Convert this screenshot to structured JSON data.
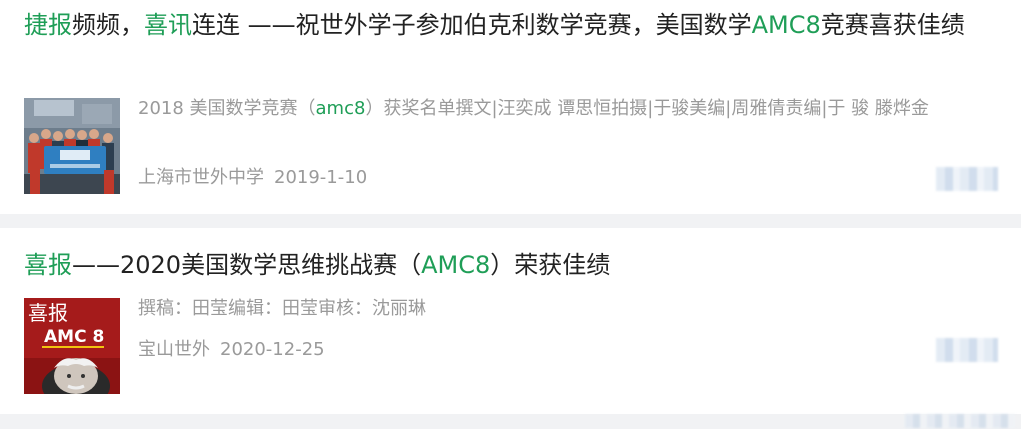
{
  "articles": [
    {
      "title_parts": [
        {
          "text": "捷报",
          "hl": true
        },
        {
          "text": "频频，",
          "hl": false
        },
        {
          "text": "喜讯",
          "hl": true
        },
        {
          "text": "连连 ——祝世外学子参加伯克利数学竞赛，美国数学",
          "hl": false
        },
        {
          "text": "AMC8",
          "hl": true
        },
        {
          "text": "竞赛喜获佳绩",
          "hl": false
        }
      ],
      "desc_parts": [
        {
          "text": "2018 美国数学竞赛（",
          "hl": false
        },
        {
          "text": "amc8",
          "hl": true
        },
        {
          "text": "）获奖名单撰文|汪奕成 谭思恒拍摄|于骏美编|周雅倩责编|于 骏 滕烨金",
          "hl": false
        }
      ],
      "source": "上海市世外中学",
      "date": "2019-1-10",
      "thumb_icon": "award-group-photo-icon"
    },
    {
      "title_parts": [
        {
          "text": "喜报",
          "hl": true
        },
        {
          "text": "——2020美国数学思维挑战赛（",
          "hl": false
        },
        {
          "text": "AMC8",
          "hl": true
        },
        {
          "text": "）荣获佳绩",
          "hl": false
        }
      ],
      "desc_parts": [
        {
          "text": "撰稿：田莹编辑：田莹审核：沈丽琳",
          "hl": false
        }
      ],
      "source": "宝山世外",
      "date": "2020-12-25",
      "thumb_icon": "good-news-poster-icon",
      "thumb_text": {
        "line1": "喜报",
        "line2": "AMC 8"
      }
    }
  ],
  "colors": {
    "highlight": "#1f9e57",
    "meta": "#9a9a9a",
    "title": "#222222",
    "background": "#f1f2f4"
  }
}
